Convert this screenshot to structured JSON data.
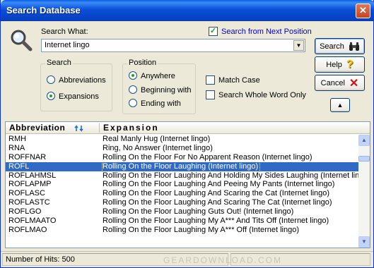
{
  "window": {
    "title": "Search Database",
    "close_glyph": "✕"
  },
  "search": {
    "label": "Search What:",
    "value": "Internet lingo",
    "from_next_label": "Search from Next Position",
    "from_next_checked": true
  },
  "search_group": {
    "title": "Search",
    "options": [
      "Abbreviations",
      "Expansions"
    ],
    "selected": "Expansions"
  },
  "position_group": {
    "title": "Position",
    "options": [
      "Anywhere",
      "Beginning with",
      "Ending with"
    ],
    "selected": "Anywhere"
  },
  "match_case": {
    "label": "Match Case",
    "checked": false
  },
  "whole_word": {
    "label": "Search Whole Word Only",
    "checked": false
  },
  "buttons": {
    "search": "Search",
    "help": "Help",
    "cancel": "Cancel",
    "collapse_glyph": "▲"
  },
  "icons": {
    "search_icon": "magnifier-icon",
    "binoculars_icon": "binoculars-icon",
    "help_icon": "question-icon",
    "cancel_icon": "red-x-icon",
    "sort_icon": "sort-arrows-icon"
  },
  "table": {
    "columns": [
      "Abbreviation",
      "Expansion"
    ],
    "selected_index": 3,
    "rows": [
      [
        "RMH",
        "Real Manly Hug (Internet lingo)"
      ],
      [
        "RNA",
        "Ring, No Answer (Internet lingo)"
      ],
      [
        "ROFFNAR",
        "Rolling On the Floor For No Apparent Reason (Internet lingo)"
      ],
      [
        "ROFL",
        "Rolling On the Floor Laughing (Internet lingo)"
      ],
      [
        "ROFLAHMSL",
        "Rolling On the Floor Laughing And Holding My Sides Laughing (Internet ling"
      ],
      [
        "ROFLAPMP",
        "Rolling On the Floor Laughing And Peeing My Pants (Internet lingo)"
      ],
      [
        "ROFLASC",
        "Rolling On the Floor Laughing And Scaring the Cat (Internet lingo)"
      ],
      [
        "ROFLASTC",
        "Rolling On the Floor Laughing And Scaring The Cat (Internet lingo)"
      ],
      [
        "ROFLGO",
        "Rolling On the Floor Laughing Guts Out! (Internet lingo)"
      ],
      [
        "ROFLMAATO",
        "Rolling On the Floor Laughing My A*** And Tits Off (Internet lingo)"
      ],
      [
        "ROFLMAO",
        "Rolling On the Floor Laughing My A*** Off (Internet lingo)"
      ]
    ]
  },
  "status": {
    "hits": "Number of Hits: 500"
  },
  "watermark": "GEARDOWNLOAD.COM",
  "colors": {
    "selection": "#316ac5",
    "title_bar": "#0b4fd6",
    "link_blue": "#0000cc"
  }
}
